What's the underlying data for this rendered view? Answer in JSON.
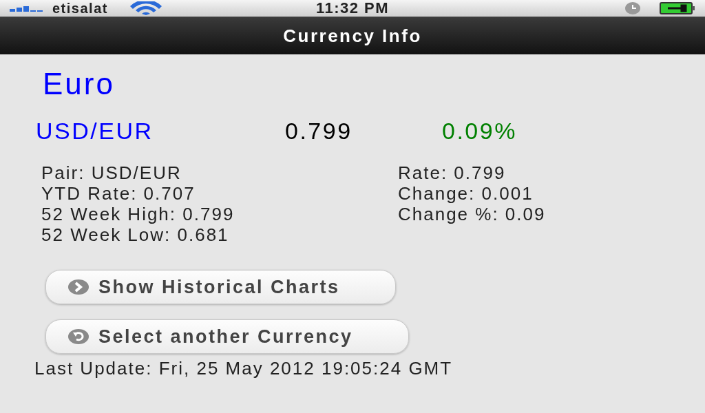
{
  "status_bar": {
    "carrier": "etisalat",
    "time": "11:32 PM"
  },
  "nav_bar": {
    "title": "Currency Info"
  },
  "currency": {
    "name": "Euro",
    "pair": "USD/EUR",
    "rate": "0.799",
    "change": "0.09%"
  },
  "details": {
    "left": [
      "Pair: USD/EUR",
      "YTD Rate: 0.707",
      "52 Week High: 0.799",
      "52 Week Low: 0.681"
    ],
    "right": [
      "Rate: 0.799",
      "Change: 0.001",
      "Change %: 0.09"
    ]
  },
  "buttons": [
    {
      "label": "Show Historical Charts",
      "kind": "forward"
    },
    {
      "label": "Select another Currency",
      "kind": "back"
    }
  ],
  "last_update": "Last Update: Fri, 25 May 2012 19:05:24 GMT"
}
